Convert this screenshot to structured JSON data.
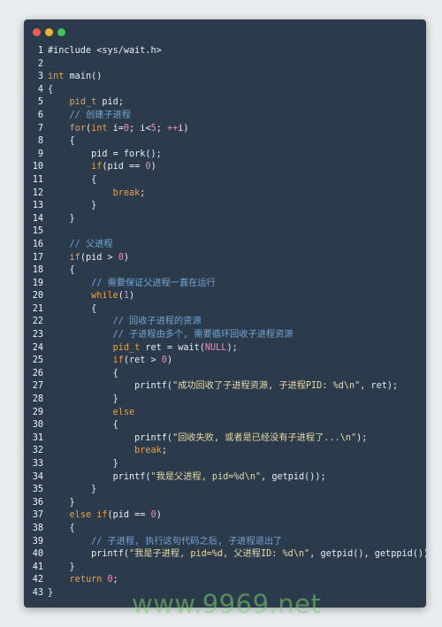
{
  "window": {
    "dots": [
      "#ee5b52",
      "#f2b02d",
      "#40c457"
    ]
  },
  "code_lines": [
    [
      {
        "t": "#include <sys/wait.h>",
        "c": "fn"
      }
    ],
    [],
    [
      {
        "t": "int",
        "c": "kw"
      },
      {
        "t": " main",
        "c": "fn"
      },
      {
        "t": "()",
        "c": "fn"
      }
    ],
    [
      {
        "t": "{",
        "c": "fn"
      }
    ],
    [
      {
        "t": "    ",
        "c": "fn"
      },
      {
        "t": "pid_t",
        "c": "ty"
      },
      {
        "t": " pid;",
        "c": "fn"
      }
    ],
    [
      {
        "t": "    ",
        "c": "fn"
      },
      {
        "t": "// 创建子进程",
        "c": "cm"
      }
    ],
    [
      {
        "t": "    ",
        "c": "fn"
      },
      {
        "t": "for",
        "c": "kw"
      },
      {
        "t": "(",
        "c": "fn"
      },
      {
        "t": "int",
        "c": "kw"
      },
      {
        "t": " i=",
        "c": "fn"
      },
      {
        "t": "0",
        "c": "num"
      },
      {
        "t": "; i<",
        "c": "fn"
      },
      {
        "t": "5",
        "c": "num"
      },
      {
        "t": "; ",
        "c": "fn"
      },
      {
        "t": "++",
        "c": "op"
      },
      {
        "t": "i)",
        "c": "fn"
      }
    ],
    [
      {
        "t": "    {",
        "c": "fn"
      }
    ],
    [
      {
        "t": "        pid = fork();",
        "c": "fn"
      }
    ],
    [
      {
        "t": "        ",
        "c": "fn"
      },
      {
        "t": "if",
        "c": "kw"
      },
      {
        "t": "(pid == ",
        "c": "fn"
      },
      {
        "t": "0",
        "c": "num"
      },
      {
        "t": ")",
        "c": "fn"
      }
    ],
    [
      {
        "t": "        {",
        "c": "fn"
      }
    ],
    [
      {
        "t": "            ",
        "c": "fn"
      },
      {
        "t": "break",
        "c": "kw"
      },
      {
        "t": ";",
        "c": "fn"
      }
    ],
    [
      {
        "t": "        }",
        "c": "fn"
      }
    ],
    [
      {
        "t": "    }",
        "c": "fn"
      }
    ],
    [],
    [
      {
        "t": "    ",
        "c": "fn"
      },
      {
        "t": "// 父进程",
        "c": "cm"
      }
    ],
    [
      {
        "t": "    ",
        "c": "fn"
      },
      {
        "t": "if",
        "c": "kw"
      },
      {
        "t": "(pid > ",
        "c": "fn"
      },
      {
        "t": "0",
        "c": "num"
      },
      {
        "t": ")",
        "c": "fn"
      }
    ],
    [
      {
        "t": "    {",
        "c": "fn"
      }
    ],
    [
      {
        "t": "        ",
        "c": "fn"
      },
      {
        "t": "// 需要保证父进程一直在运行",
        "c": "cm"
      }
    ],
    [
      {
        "t": "        ",
        "c": "fn"
      },
      {
        "t": "while",
        "c": "kw"
      },
      {
        "t": "(",
        "c": "fn"
      },
      {
        "t": "1",
        "c": "num"
      },
      {
        "t": ")",
        "c": "fn"
      }
    ],
    [
      {
        "t": "        {",
        "c": "fn"
      }
    ],
    [
      {
        "t": "            ",
        "c": "fn"
      },
      {
        "t": "// 回收子进程的资源",
        "c": "cm"
      }
    ],
    [
      {
        "t": "            ",
        "c": "fn"
      },
      {
        "t": "// 子进程由多个, 需要循环回收子进程资源",
        "c": "cm"
      }
    ],
    [
      {
        "t": "            ",
        "c": "fn"
      },
      {
        "t": "pid_t",
        "c": "ty"
      },
      {
        "t": " ret = wait(",
        "c": "fn"
      },
      {
        "t": "NULL",
        "c": "num"
      },
      {
        "t": ");",
        "c": "fn"
      }
    ],
    [
      {
        "t": "            ",
        "c": "fn"
      },
      {
        "t": "if",
        "c": "kw"
      },
      {
        "t": "(ret > ",
        "c": "fn"
      },
      {
        "t": "0",
        "c": "num"
      },
      {
        "t": ")",
        "c": "fn"
      }
    ],
    [
      {
        "t": "            {",
        "c": "fn"
      }
    ],
    [
      {
        "t": "                printf(",
        "c": "fn"
      },
      {
        "t": "\"成功回收了子进程资源, 子进程PID: %d\\n\"",
        "c": "str"
      },
      {
        "t": ", ret);",
        "c": "fn"
      }
    ],
    [
      {
        "t": "            }",
        "c": "fn"
      }
    ],
    [
      {
        "t": "            ",
        "c": "fn"
      },
      {
        "t": "else",
        "c": "kw"
      }
    ],
    [
      {
        "t": "            {",
        "c": "fn"
      }
    ],
    [
      {
        "t": "                printf(",
        "c": "fn"
      },
      {
        "t": "\"回收失败, 或者是已经没有子进程了...\\n\"",
        "c": "str"
      },
      {
        "t": ");",
        "c": "fn"
      }
    ],
    [
      {
        "t": "                ",
        "c": "fn"
      },
      {
        "t": "break",
        "c": "kw"
      },
      {
        "t": ";",
        "c": "fn"
      }
    ],
    [
      {
        "t": "            }",
        "c": "fn"
      }
    ],
    [
      {
        "t": "            printf(",
        "c": "fn"
      },
      {
        "t": "\"我是父进程, pid=%d\\n\"",
        "c": "str"
      },
      {
        "t": ", getpid());",
        "c": "fn"
      }
    ],
    [
      {
        "t": "        }",
        "c": "fn"
      }
    ],
    [
      {
        "t": "    }",
        "c": "fn"
      }
    ],
    [
      {
        "t": "    ",
        "c": "fn"
      },
      {
        "t": "else",
        "c": "kw"
      },
      {
        "t": " ",
        "c": "fn"
      },
      {
        "t": "if",
        "c": "kw"
      },
      {
        "t": "(pid == ",
        "c": "fn"
      },
      {
        "t": "0",
        "c": "num"
      },
      {
        "t": ")",
        "c": "fn"
      }
    ],
    [
      {
        "t": "    {",
        "c": "fn"
      }
    ],
    [
      {
        "t": "        ",
        "c": "fn"
      },
      {
        "t": "// 子进程, 执行这句代码之后, 子进程退出了",
        "c": "cm"
      }
    ],
    [
      {
        "t": "        printf(",
        "c": "fn"
      },
      {
        "t": "\"我是子进程, pid=%d, 父进程ID: %d\\n\"",
        "c": "str"
      },
      {
        "t": ", getpid(), getppid());",
        "c": "fn"
      }
    ],
    [
      {
        "t": "    }",
        "c": "fn"
      }
    ],
    [
      {
        "t": "    ",
        "c": "fn"
      },
      {
        "t": "return",
        "c": "kw"
      },
      {
        "t": " ",
        "c": "fn"
      },
      {
        "t": "0",
        "c": "num"
      },
      {
        "t": ";",
        "c": "fn"
      }
    ],
    [
      {
        "t": "}",
        "c": "fn"
      }
    ]
  ],
  "watermark": "www.9969.net"
}
